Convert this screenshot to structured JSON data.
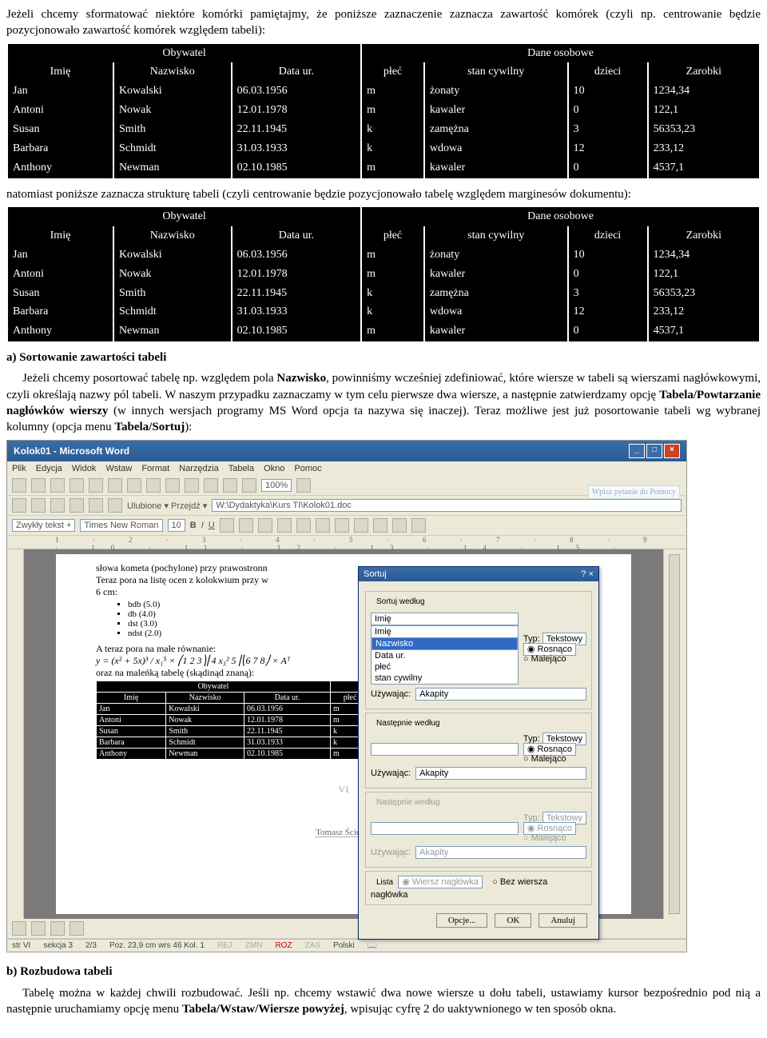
{
  "para1": "Jeżeli chcemy sformatować niektóre komórki pamiętajmy, że poniższe zaznaczenie zaznacza zawartość komórek (czyli np. centrowanie będzie pozycjonowało zawartość komórek względem tabeli):",
  "table_headers1": [
    "Obywatel",
    "Dane osobowe"
  ],
  "table_headers2": [
    "Imię",
    "Nazwisko",
    "Data ur.",
    "płeć",
    "stan cywilny",
    "dzieci",
    "Zarobki"
  ],
  "rows": [
    [
      "Jan",
      "Kowalski",
      "06.03.1956",
      "m",
      "żonaty",
      "10",
      "1234,34"
    ],
    [
      "Antoni",
      "Nowak",
      "12.01.1978",
      "m",
      "kawaler",
      "0",
      "122,1"
    ],
    [
      "Susan",
      "Smith",
      "22.11.1945",
      "k",
      "zamężna",
      "3",
      "56353,23"
    ],
    [
      "Barbara",
      "Schmidt",
      "31.03.1933",
      "k",
      "wdowa",
      "12",
      "233,12"
    ],
    [
      "Anthony",
      "Newman",
      "02.10.1985",
      "m",
      "kawaler",
      "0",
      "4537,1"
    ]
  ],
  "para2": "natomiast poniższe zaznacza strukturę tabeli (czyli centrowanie będzie pozycjonowało tabelę względem marginesów dokumentu):",
  "sec_a_title": "a) Sortowanie zawartości tabeli",
  "sec_a_text1": "Jeżeli chcemy posortować tabelę np. względem pola ",
  "sec_a_bold1": "Nazwisko",
  "sec_a_text2": ", powinniśmy wcześniej zdefiniować, które wiersze w tabeli są wierszami nagłówkowymi, czyli określają nazwy pól tabeli. W naszym przypadku zaznaczamy w tym celu pierwsze dwa wiersze, a następnie zatwierdzamy opcję ",
  "sec_a_bold2": "Tabela/Powtarzanie nagłówków wierszy",
  "sec_a_text3": " (w innych wersjach programy MS Word opcja ta nazywa się inaczej). Teraz możliwe jest już posortowanie tabeli wg wybranej kolumny (opcja menu ",
  "sec_a_bold3": "Tabela/Sortuj",
  "sec_a_text4": "):",
  "word": {
    "title": "Kolok01 - Microsoft Word",
    "menu": [
      "Plik",
      "Edycja",
      "Widok",
      "Wstaw",
      "Format",
      "Narzędzia",
      "Tabela",
      "Okno",
      "Pomoc"
    ],
    "helpbox": "Wpisz pytanie do Pomocy",
    "style": "Zwykły tekst +",
    "font": "Times New Roman",
    "size": "10",
    "zoom": "100%",
    "path_prefix": "Ulubione ▾  Przejdź ▾",
    "path": "W:\\Dydaktyka\\Kurs TI\\Kolok01.doc",
    "ruler": "1 · 2 · 3 · 4 · 5 · 6 · 7 · 8 · 9 · 10 · 11 · 12 · 13 · 14 · 15 · 16 ·",
    "doc_line1": "słowa kometa (pochylone) przy prawostronn",
    "doc_line2": "Teraz pora na listę ocen z kolokwium przy w",
    "doc_line2b": "6 cm:",
    "bullets": [
      "bdb (5.0)",
      "db (4.0)",
      "dst (3.0)",
      "ndst (2.0)"
    ],
    "doc_line3": "A teraz pora na małe równanie:",
    "eq": "y = (x² + 5x)³ / x₁⁵ × ⎛1 2 3⎞⎜4 x₃² 5⎟⎝6 7 8⎠ × Aᵀ",
    "doc_line4": "oraz na maleńką tabelę (skądinąd znaną):",
    "page_label": "VI",
    "footer_name": "Tomasz Ściężor",
    "status": [
      "str VI",
      "sekcja 3",
      "2/3",
      "Poz. 23,9 cm  wrs 46  Kol. 1",
      "REJ",
      "ZMN",
      "ROZ",
      "ZAS",
      "Polski"
    ]
  },
  "dialog": {
    "title": "Sortuj",
    "f1": "Sortuj według",
    "sel1": "Imię",
    "selopts": [
      "Imię",
      "Nazwisko",
      "Data ur.",
      "płeć",
      "stan cywilny"
    ],
    "typ": "Typ:",
    "typval": "Tekstowy",
    "asc": "Rosnąco",
    "desc": "Malejąco",
    "using": "Używając:",
    "usingval": "Akapity",
    "f2": "Następnie według",
    "f3": "Następnie według",
    "listlabel": "Lista",
    "r1": "Wiersz nagłówka",
    "r2": "Bez wiersza nagłówka",
    "opcje": "Opcje...",
    "ok": "OK",
    "cancel": "Anuluj"
  },
  "sec_b_title": "b) Rozbudowa tabeli",
  "sec_b_text1": "Tabelę można w każdej chwili rozbudować. Jeśli np. chcemy wstawić dwa nowe wiersze u dołu tabeli, ustawiamy kursor bezpośrednio pod nią a następnie uruchamiamy opcję menu ",
  "sec_b_bold1": "Tabela/Wstaw/Wiersze powyżej",
  "sec_b_text2": ", wpisując cyfrę 2 do uaktywnionego w ten sposób okna."
}
